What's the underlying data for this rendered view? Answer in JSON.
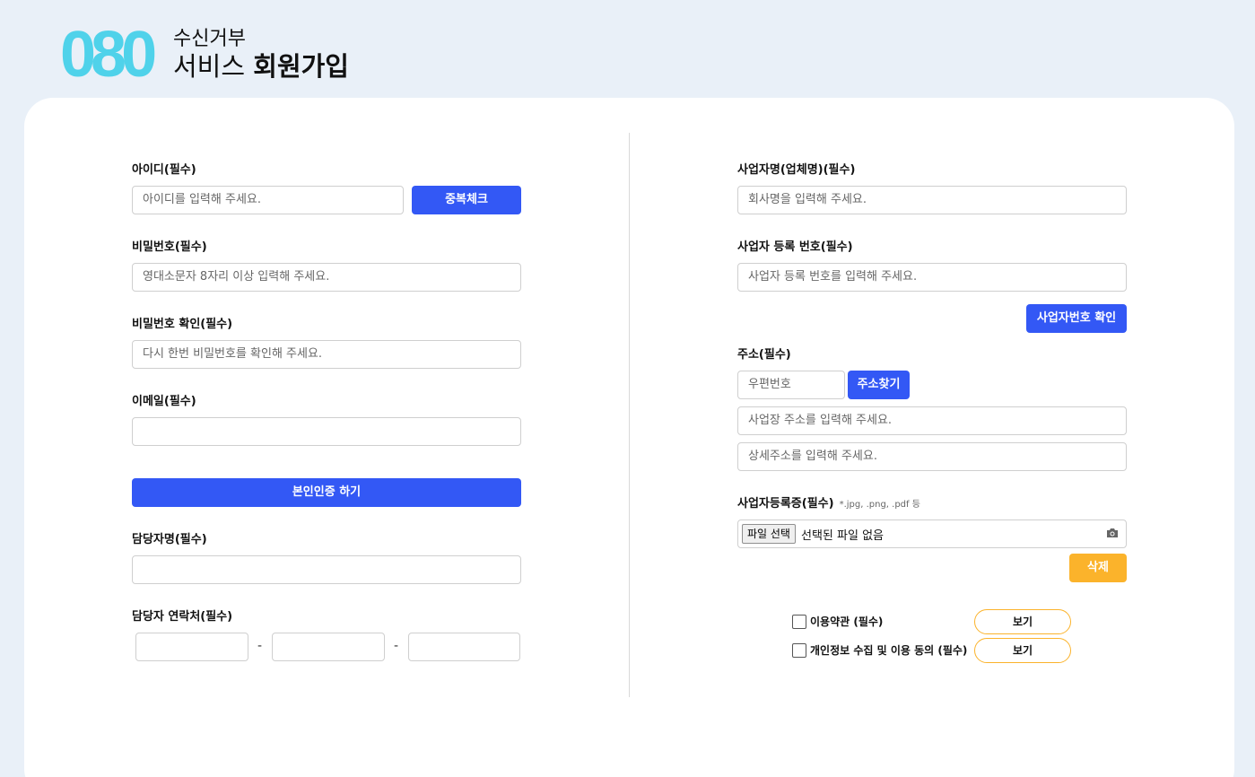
{
  "header": {
    "logo_number": "080",
    "logo_line1": "수신거부",
    "logo_line2_light": "서비스",
    "logo_line2_bold": "회원가입"
  },
  "left": {
    "id_label": "아이디(필수)",
    "id_placeholder": "아이디를 입력해 주세요.",
    "dup_check_button": "중복체크",
    "password_label": "비밀번호(필수)",
    "password_placeholder": "영대소문자 8자리 이상 입력해 주세요.",
    "password_confirm_label": "비밀번호 확인(필수)",
    "password_confirm_placeholder": "다시 한번 비밀번호를 확인해 주세요.",
    "email_label": "이메일(필수)",
    "email_value": "",
    "verify_button": "본인인증 하기",
    "manager_name_label": "담당자명(필수)",
    "manager_name_value": "",
    "manager_phone_label": "담당자 연락처(필수)",
    "phone_separator": "-"
  },
  "right": {
    "company_name_label": "사업자명(업체명)(필수)",
    "company_name_placeholder": "회사명을 입력해 주세요.",
    "biz_number_label": "사업자 등록 번호(필수)",
    "biz_number_placeholder": "사업자 등록 번호를 입력해 주세요.",
    "biz_verify_button": "사업자번호 확인",
    "address_label": "주소(필수)",
    "zipcode_placeholder": "우편번호",
    "address_search_button": "주소찾기",
    "address_placeholder": "사업장 주소를 입력해 주세요.",
    "address_detail_placeholder": "상세주소를 입력해 주세요.",
    "biz_cert_label": "사업자등록증(필수)",
    "biz_cert_hint": "*.jpg, .png, .pdf 등",
    "file_choose_button": "파일 선택",
    "file_status": "선택된 파일 없음",
    "delete_button": "삭제",
    "terms_label": "이용약관 (필수)",
    "privacy_label": "개인정보 수집 및 이용 동의 (필수)",
    "view_button": "보기"
  },
  "colors": {
    "accent_blue": "#3358f5",
    "accent_orange": "#fbb32b",
    "logo_cyan": "#4fd2ea",
    "background": "#e9f0f8"
  }
}
